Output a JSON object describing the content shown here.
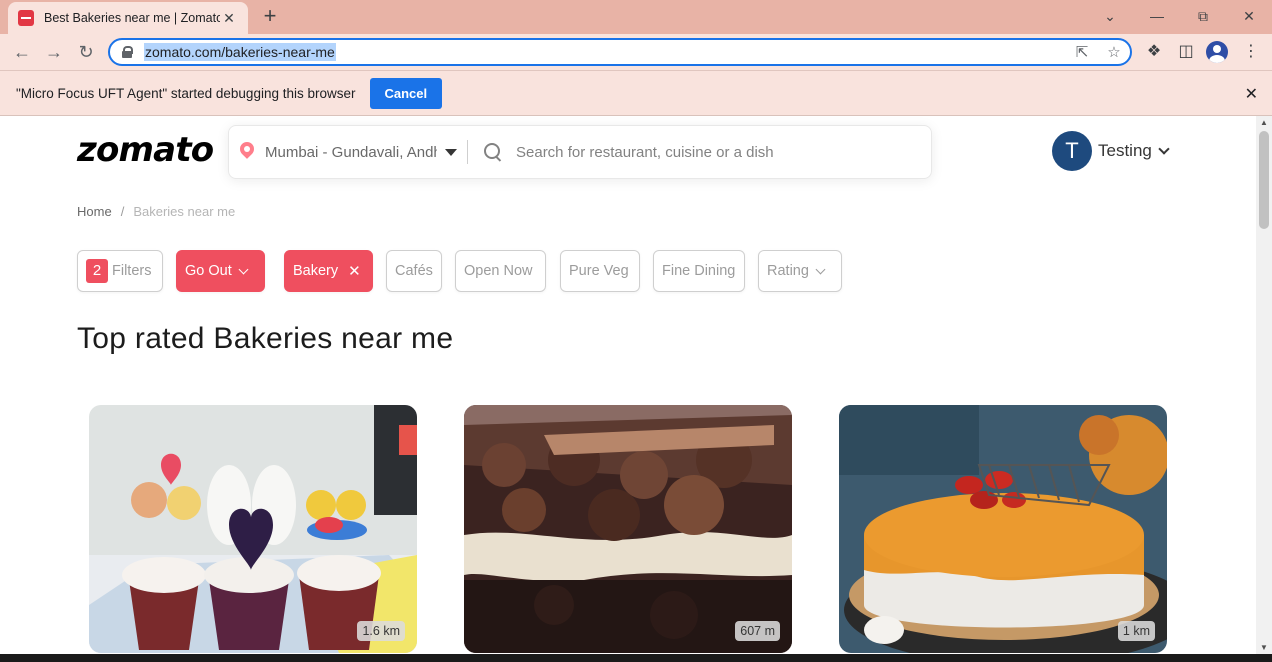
{
  "browser": {
    "tab_title": "Best Bakeries near me | Zomato",
    "tab_close": "✕",
    "new_tab": "+",
    "url": "zomato.com/bakeries-near-me",
    "infobar_text": "\"Micro Focus UFT Agent\" started debugging this browser",
    "infobar_cancel": "Cancel",
    "infobar_close": "✕",
    "accent": "#1a73e8"
  },
  "header": {
    "logo": "zomato",
    "location": "Mumbai - Gundavali, Andheri",
    "search_placeholder": "Search for restaurant, cuisine or a dish",
    "user_initial": "T",
    "user_name": "Testing"
  },
  "breadcrumb": {
    "home": "Home",
    "separator": "/",
    "current": "Bakeries near me"
  },
  "filters": {
    "count": "2",
    "filters_label": "Filters",
    "go_out": "Go Out",
    "bakery": "Bakery",
    "cafes": "Cafés",
    "open_now": "Open Now",
    "pure_veg": "Pure Veg",
    "fine_dining": "Fine Dining",
    "rating": "Rating",
    "accent": "#ef4f5f"
  },
  "main": {
    "heading": "Top rated Bakeries near me",
    "cards": [
      {
        "distance": "1.6 km"
      },
      {
        "distance": "607 m"
      },
      {
        "distance": "1 km"
      }
    ]
  }
}
